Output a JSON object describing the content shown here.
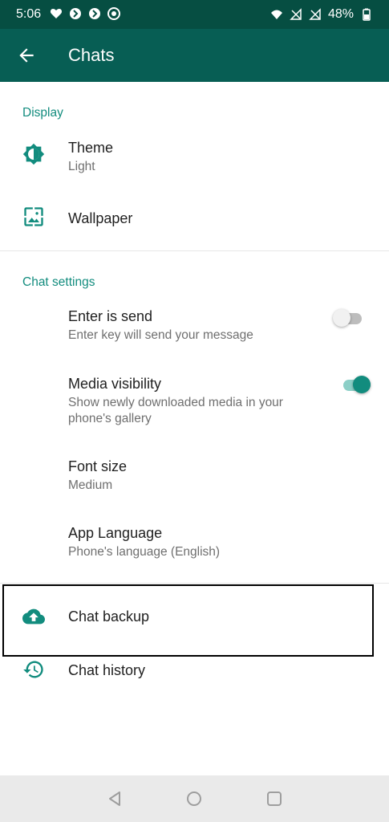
{
  "status_bar": {
    "time": "5:06",
    "battery": "48%",
    "left_icons": [
      "heart-monitor-icon",
      "app-icon",
      "app-icon",
      "chrome-icon"
    ],
    "right_icons": [
      "wifi-icon",
      "no-signal-icon",
      "no-signal-icon",
      "battery-icon"
    ]
  },
  "app_bar": {
    "title": "Chats",
    "back_icon": "arrow-back-icon"
  },
  "sections": {
    "display": "Display",
    "chat_settings": "Chat settings"
  },
  "items": {
    "theme": {
      "title": "Theme",
      "subtitle": "Light",
      "icon": "brightness-icon"
    },
    "wallpaper": {
      "title": "Wallpaper",
      "icon": "wallpaper-icon"
    },
    "enter_is_send": {
      "title": "Enter is send",
      "subtitle": "Enter key will send your message",
      "enabled": false
    },
    "media_visibility": {
      "title": "Media visibility",
      "subtitle_line1": "Show newly downloaded media in your",
      "subtitle_line2": "phone's gallery",
      "enabled": true
    },
    "font_size": {
      "title": "Font size",
      "subtitle": "Medium"
    },
    "app_language": {
      "title": "App Language",
      "subtitle": "Phone's language (English)"
    },
    "chat_backup": {
      "title": "Chat backup",
      "icon": "cloud-upload-icon"
    },
    "chat_history": {
      "title": "Chat history",
      "icon": "history-icon"
    }
  },
  "colors": {
    "accent": "#128c7e",
    "appbar": "#075e54",
    "statusbar": "#064e42",
    "switch_on": "#128c7e"
  },
  "nav_bar": {
    "buttons": [
      "back-triangle-icon",
      "home-circle-icon",
      "recents-square-icon"
    ]
  }
}
